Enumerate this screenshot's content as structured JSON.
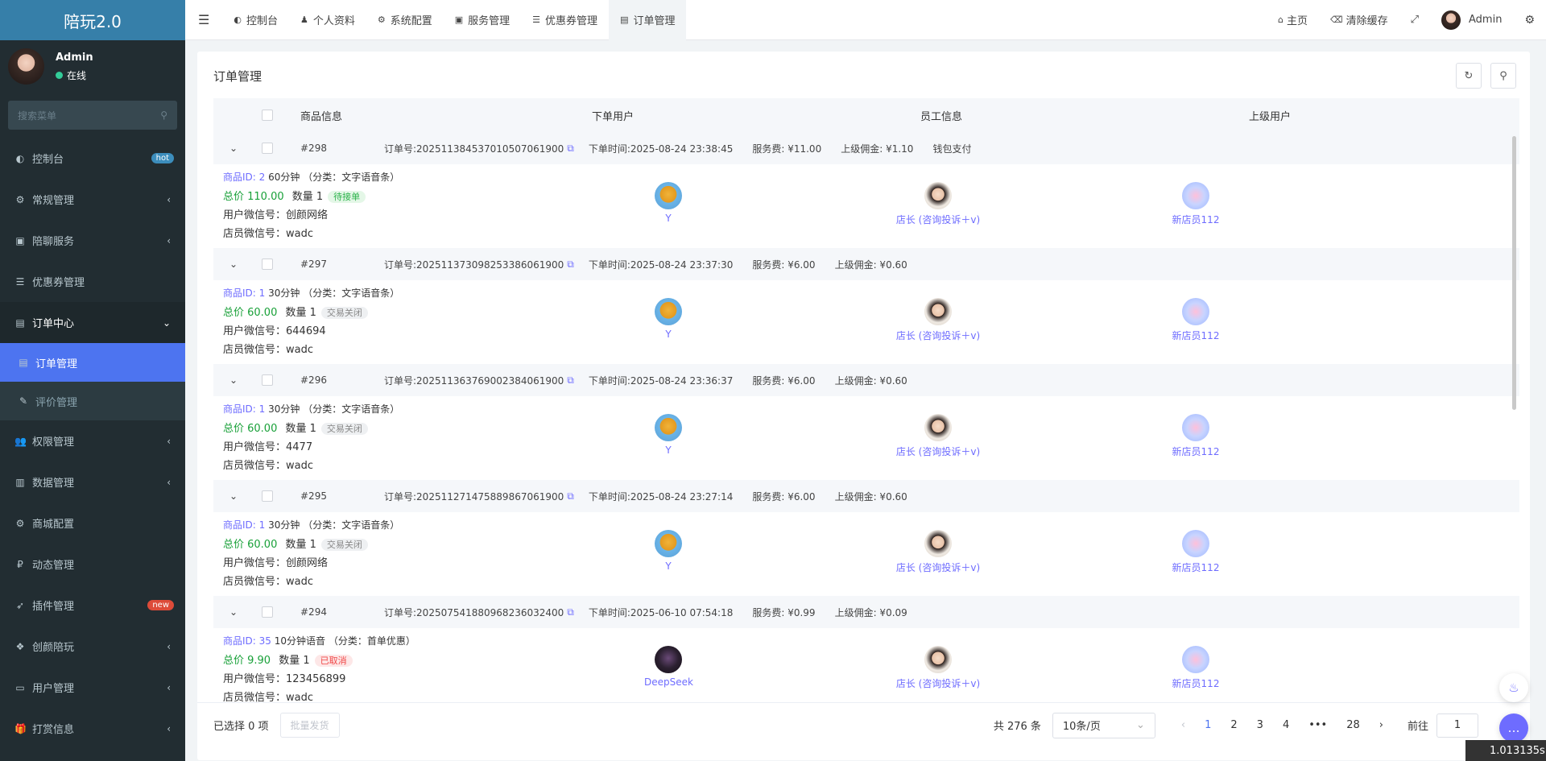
{
  "app": {
    "title": "陪玩2.0"
  },
  "user": {
    "name": "Admin",
    "status": "在线"
  },
  "sidebar": {
    "search_placeholder": "搜索菜单",
    "items": [
      {
        "label": "控制台",
        "icon": "dashboard-icon",
        "badge": "hot",
        "badge_color": "#3c8dbc"
      },
      {
        "label": "常规管理",
        "icon": "gears-icon",
        "arrow": "‹"
      },
      {
        "label": "陪聊服务",
        "icon": "box-icon",
        "arrow": "‹"
      },
      {
        "label": "优惠券管理",
        "icon": "list-icon"
      },
      {
        "label": "订单中心",
        "icon": "file-icon",
        "arrow": "⌄"
      },
      {
        "label": "订单管理",
        "icon": "file-icon"
      },
      {
        "label": "评价管理",
        "icon": "edit-icon"
      },
      {
        "label": "权限管理",
        "icon": "users-icon",
        "arrow": "‹"
      },
      {
        "label": "数据管理",
        "icon": "bar-chart-icon",
        "arrow": "‹"
      },
      {
        "label": "商城配置",
        "icon": "gears-icon"
      },
      {
        "label": "动态管理",
        "icon": "ruble-icon"
      },
      {
        "label": "插件管理",
        "icon": "rocket-icon",
        "badge": "new",
        "badge_color": "#dd4b39"
      },
      {
        "label": "创颜陪玩",
        "icon": "dropbox-icon",
        "arrow": "‹"
      },
      {
        "label": "用户管理",
        "icon": "id-card-icon",
        "arrow": "‹"
      },
      {
        "label": "打赏信息",
        "icon": "gift-icon",
        "arrow": "‹"
      }
    ]
  },
  "topbar": {
    "tabs": [
      "控制台",
      "个人资料",
      "系统配置",
      "服务管理",
      "优惠券管理",
      "订单管理"
    ],
    "home": "主页",
    "clear_cache": "清除缓存",
    "admin": "Admin"
  },
  "panel": {
    "title": "订单管理",
    "columns": [
      "商品信息",
      "下单用户",
      "员工信息",
      "上级用户"
    ]
  },
  "orders": [
    {
      "id": "#298",
      "order_no": "订单号:2025113845370105070619​00",
      "time": "下单时间:2025-08-24 23:38:45",
      "fee": "服务费: ¥11.00",
      "commission": "上级佣金: ¥1.10",
      "pay": "钱包支付",
      "goods_id": "商品ID: 2",
      "goods": "60分钟 （分类：文字语音条）",
      "total": "总价 110.00",
      "qty": "数量 1",
      "status": "待接单",
      "status_type": "wait",
      "user_wx": "用户微信号：创颜网络",
      "staff_wx": "店员微信号：wadc",
      "buyer": "Y",
      "buyer_av": "user",
      "staff": "店长 (咨询投诉＋v)",
      "sup": "新店员112"
    },
    {
      "id": "#297",
      "order_no": "订单号:2025113730982533860619​00",
      "time": "下单时间:2025-08-24 23:37:30",
      "fee": "服务费: ¥6.00",
      "commission": "上级佣金: ¥0.60",
      "pay": "",
      "goods_id": "商品ID: 1",
      "goods": "30分钟 （分类：文字语音条）",
      "total": "总价 60.00",
      "qty": "数量 1",
      "status": "交易关闭",
      "status_type": "closed",
      "user_wx": "用户微信号：644694",
      "staff_wx": "店员微信号：wadc",
      "buyer": "Y",
      "buyer_av": "user",
      "staff": "店长 (咨询投诉＋v)",
      "sup": "新店员112"
    },
    {
      "id": "#296",
      "order_no": "订单号:2025113637690023840619​00",
      "time": "下单时间:2025-08-24 23:36:37",
      "fee": "服务费: ¥6.00",
      "commission": "上级佣金: ¥0.60",
      "pay": "",
      "goods_id": "商品ID: 1",
      "goods": "30分钟 （分类：文字语音条）",
      "total": "总价 60.00",
      "qty": "数量 1",
      "status": "交易关闭",
      "status_type": "closed",
      "user_wx": "用户微信号：4477",
      "staff_wx": "店员微信号：wadc",
      "buyer": "Y",
      "buyer_av": "user",
      "staff": "店长 (咨询投诉＋v)",
      "sup": "新店员112"
    },
    {
      "id": "#295",
      "order_no": "订单号:2025112714758898670619​00",
      "time": "下单时间:2025-08-24 23:27:14",
      "fee": "服务费: ¥6.00",
      "commission": "上级佣金: ¥0.60",
      "pay": "",
      "goods_id": "商品ID: 1",
      "goods": "30分钟 （分类：文字语音条）",
      "total": "总价 60.00",
      "qty": "数量 1",
      "status": "交易关闭",
      "status_type": "closed",
      "user_wx": "用户微信号：创颜网络",
      "staff_wx": "店员微信号：wadc",
      "buyer": "Y",
      "buyer_av": "user",
      "staff": "店长 (咨询投诉＋v)",
      "sup": "新店员112"
    },
    {
      "id": "#294",
      "order_no": "订单号:2025075418809682360324​00",
      "time": "下单时间:2025-06-10 07:54:18",
      "fee": "服务费: ¥0.99",
      "commission": "上级佣金: ¥0.09",
      "pay": "",
      "goods_id": "商品ID: 35",
      "goods": "10分钟语音 （分类：首单优惠）",
      "total": "总价 9.90",
      "qty": "数量 1",
      "status": "已取消",
      "status_type": "cancel",
      "user_wx": "用户微信号：123456899",
      "staff_wx": "店员微信号：wadc",
      "buyer": "DeepSeek",
      "buyer_av": "ds",
      "staff": "店长 (咨询投诉＋v)",
      "sup": "新店员112"
    }
  ],
  "footer": {
    "selected": "已选择 0 项",
    "batch": "批量发货",
    "total": "共 276 条",
    "page_size": "10条/页",
    "pages": [
      "1",
      "2",
      "3",
      "4",
      "•••",
      "28"
    ],
    "goto": "前往",
    "goto_value": "1"
  },
  "timer": "1.013135s"
}
